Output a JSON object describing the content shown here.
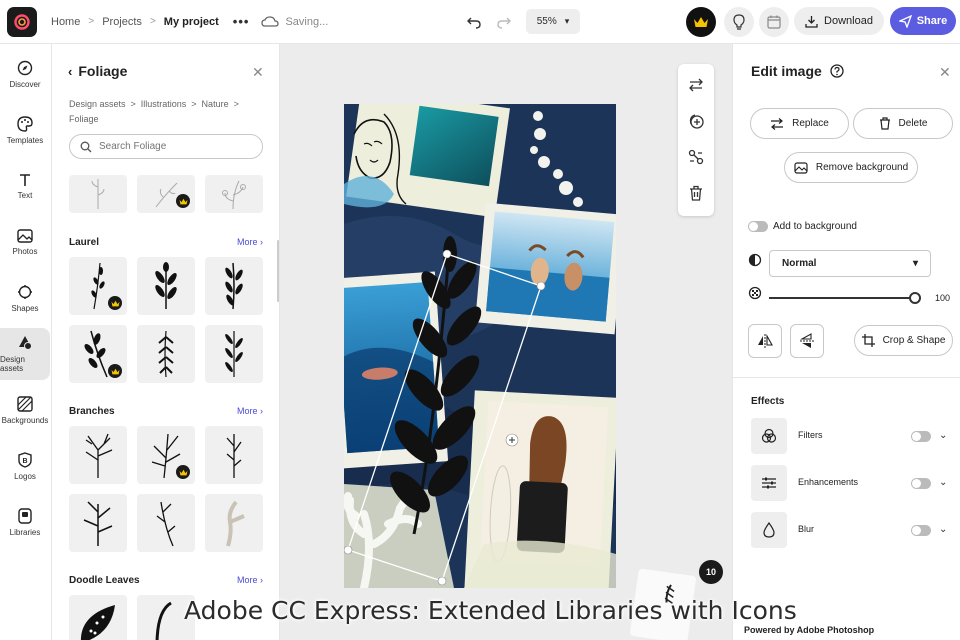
{
  "topbar": {
    "breadcrumb": [
      "Home",
      "Projects",
      "My project"
    ],
    "saving_text": "Saving...",
    "zoom": "55%",
    "download_label": "Download",
    "share_label": "Share"
  },
  "leftnav": {
    "items": [
      {
        "label": "Discover",
        "icon": "compass-icon"
      },
      {
        "label": "Templates",
        "icon": "palette-icon"
      },
      {
        "label": "Text",
        "icon": "text-icon"
      },
      {
        "label": "Photos",
        "icon": "photo-icon"
      },
      {
        "label": "Shapes",
        "icon": "shapes-icon"
      },
      {
        "label": "Design assets",
        "icon": "design-assets-icon"
      },
      {
        "label": "Backgrounds",
        "icon": "backgrounds-icon"
      },
      {
        "label": "Logos",
        "icon": "logo-icon"
      },
      {
        "label": "Libraries",
        "icon": "libraries-icon"
      }
    ],
    "active": "Design assets"
  },
  "asset_panel": {
    "title": "Foliage",
    "breadcrumb": "Design assets  >  Illustrations  >  Nature  >",
    "breadcrumb_current": "Foliage",
    "search_placeholder": "Search Foliage",
    "sections": [
      {
        "title": "Laurel",
        "more": "More"
      },
      {
        "title": "Branches",
        "more": "More"
      },
      {
        "title": "Doodle Leaves",
        "more": "More"
      }
    ]
  },
  "canvas": {
    "page_count": "10"
  },
  "edit_panel": {
    "title": "Edit image",
    "replace_label": "Replace",
    "delete_label": "Delete",
    "remove_bg_label": "Remove background",
    "add_to_bg_label": "Add to background",
    "blend_mode": "Normal",
    "opacity": "100",
    "crop_label": "Crop & Shape",
    "effects_title": "Effects",
    "effects": [
      {
        "label": "Filters",
        "icon": "filters-icon"
      },
      {
        "label": "Enhancements",
        "icon": "sliders-icon"
      },
      {
        "label": "Blur",
        "icon": "droplet-icon"
      }
    ]
  },
  "caption": "Adobe CC Express: Extended Libraries with Icons",
  "powered_by": "Powered by Adobe Photoshop",
  "colors": {
    "accent": "#5c5ce0",
    "link": "#4b4bd6",
    "artboard_bg": "#1d3459",
    "crown_bg": "#1a1a1a",
    "crown_fg": "#f5c400"
  }
}
